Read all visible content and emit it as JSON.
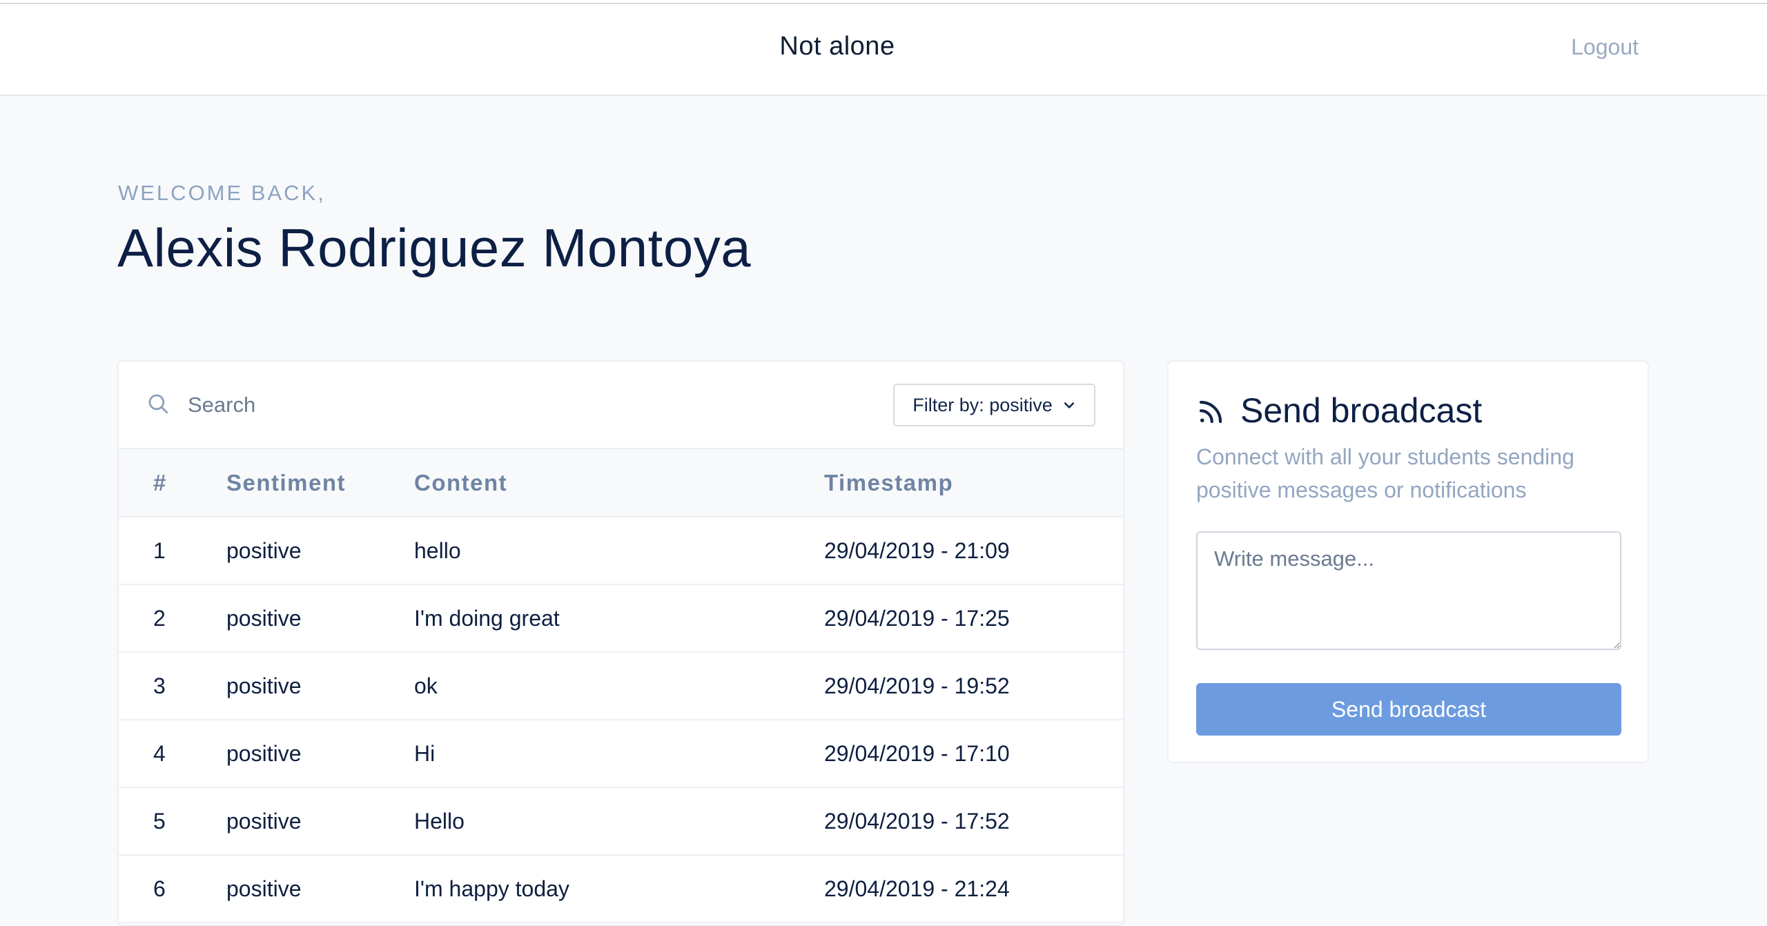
{
  "header": {
    "brand": "Not alone",
    "logout_label": "Logout"
  },
  "welcome": {
    "label": "WELCOME BACK,",
    "name": "Alexis Rodriguez Montoya"
  },
  "search": {
    "placeholder": "Search",
    "filter_label": "Filter by: positive"
  },
  "table": {
    "columns": [
      "#",
      "Sentiment",
      "Content",
      "Timestamp"
    ],
    "rows": [
      {
        "num": "1",
        "sentiment": "positive",
        "content": "hello",
        "timestamp": "29/04/2019 - 21:09"
      },
      {
        "num": "2",
        "sentiment": "positive",
        "content": "I'm doing great",
        "timestamp": "29/04/2019 - 17:25"
      },
      {
        "num": "3",
        "sentiment": "positive",
        "content": "ok",
        "timestamp": "29/04/2019 - 19:52"
      },
      {
        "num": "4",
        "sentiment": "positive",
        "content": "Hi",
        "timestamp": "29/04/2019 - 17:10"
      },
      {
        "num": "5",
        "sentiment": "positive",
        "content": "Hello",
        "timestamp": "29/04/2019 - 17:52"
      },
      {
        "num": "6",
        "sentiment": "positive",
        "content": "I'm happy today",
        "timestamp": "29/04/2019 - 21:24"
      }
    ]
  },
  "broadcast": {
    "title": "Send broadcast",
    "description": "Connect with all your students sending positive messages or notifications",
    "placeholder": "Write message...",
    "button_label": "Send broadcast"
  },
  "icons": {
    "search": "search-icon",
    "chevron": "chevron-down-icon",
    "rss": "rss-icon"
  },
  "colors": {
    "accent": "#6c9be0",
    "text_dark": "#0d1f44",
    "text_muted": "#93a6c1"
  }
}
